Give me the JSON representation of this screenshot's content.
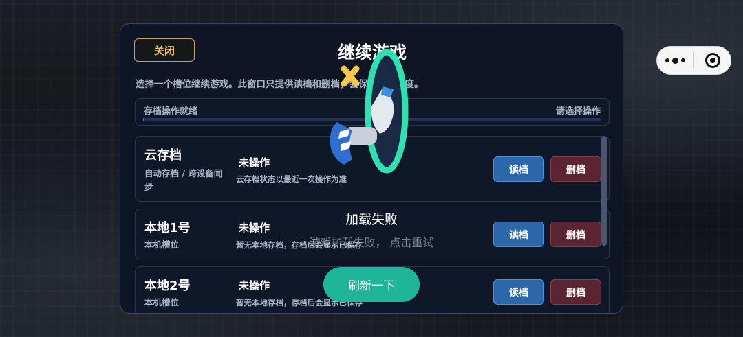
{
  "mini_program_capsule": {
    "more_icon": "more-dots-icon",
    "close_icon": "target-circle-icon"
  },
  "modal": {
    "close_label": "关闭",
    "title": "继续游戏",
    "subtitle": "选择一个槽位继续游戏。此窗口只提供读档和删档，会保存当前进度。",
    "status_left": "存档操作就绪",
    "status_right": "请选择操作",
    "progress_fraction": 0.003,
    "slots": [
      {
        "name": "云存档",
        "desc": "自动存档 / 跨设备同步",
        "state": "未操作",
        "note": "云存档状态以最近一次操作为准",
        "load_label": "读档",
        "delete_label": "删档"
      },
      {
        "name": "本地1号",
        "desc": "本机槽位",
        "state": "未操作",
        "note": "暂无本地存档，存档后会显示已保存",
        "load_label": "读档",
        "delete_label": "删档"
      },
      {
        "name": "本地2号",
        "desc": "本机槽位",
        "state": "未操作",
        "note": "暂无本地存档，存档后会显示已保存",
        "load_label": "读档",
        "delete_label": "删档"
      }
    ]
  },
  "error_overlay": {
    "title": "加载失败",
    "message": "游戏加载失败，  点击重试",
    "refresh_label": "刷新一下"
  },
  "colors": {
    "accent_gold": "#e8c25a",
    "load_blue": "#2d67ab",
    "delete_red": "#5a2430",
    "refresh_teal": "#1fb59a",
    "portal_green": "#2fe0b0"
  }
}
